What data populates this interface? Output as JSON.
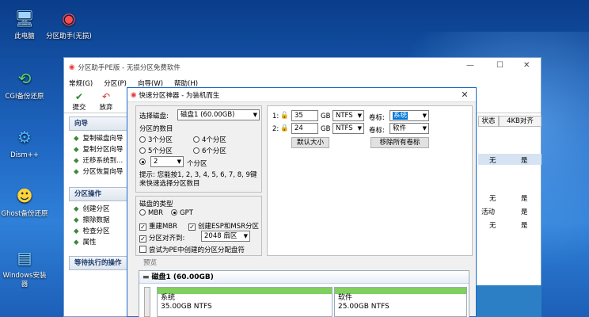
{
  "desktop": {
    "icons": [
      {
        "label": "此电脑",
        "glyph": "🖥"
      },
      {
        "label": "分区助手(无损)",
        "glyph": "◉"
      },
      {
        "label": "CGI备份还原",
        "glyph": "⟲"
      },
      {
        "label": "Dism++",
        "glyph": "⚙"
      },
      {
        "label": "Ghost备份还原",
        "glyph": "☻"
      },
      {
        "label": "Windows安装器",
        "glyph": "▤"
      }
    ]
  },
  "app": {
    "title": "分区助手PE版 - 无损分区免费软件",
    "window_controls": {
      "minimize": "—",
      "maximize": "☐",
      "close": "✕"
    },
    "menu": [
      "常规(G)",
      "分区(P)",
      "向导(W)",
      "帮助(H)"
    ],
    "toolbar": [
      "提交",
      "放弃"
    ],
    "left": {
      "wizard_title": "向导",
      "wizard_items": [
        "复制磁盘向导",
        "复制分区向导",
        "迁移系统到...",
        "分区恢复向导"
      ],
      "ops_title": "分区操作",
      "ops_items": [
        "创建分区",
        "擦除数据",
        "检查分区",
        "属性"
      ],
      "pending_title": "等待执行的操作"
    },
    "grid": {
      "headers": [
        "状态",
        "4KB对齐"
      ],
      "rows": [
        {
          "status": "无",
          "align": "是"
        },
        {
          "status": "无",
          "align": "是"
        },
        {
          "status": "活动",
          "align": "是"
        },
        {
          "status": "无",
          "align": "是"
        }
      ]
    }
  },
  "dialog": {
    "title": "快速分区神器 - 为装机而生",
    "close": "✕",
    "disk_label": "选择磁盘:",
    "disk_value": "磁盘1 (60.00GB)",
    "count_label": "分区的数目",
    "count_options": [
      "3个分区",
      "4个分区",
      "5个分区",
      "6个分区"
    ],
    "custom_value": "2",
    "custom_unit": "个分区",
    "hint": "提示: 您能按1, 2, 3, 4, 5, 6, 7, 8, 9键来快速选择分区数目",
    "type_label": "磁盘的类型",
    "mbr": "MBR",
    "gpt": "GPT",
    "opt_msr": "重建MBR",
    "opt_esp": "创建ESP和MSR分区",
    "opt_align": "分区对齐到:",
    "align_value": "2048 扇区",
    "opt_pe": "尝试为PE中创建的分区分配盘符",
    "rows": [
      {
        "idx": "1:",
        "size": "35",
        "unit": "GB",
        "fs": "NTFS",
        "vlabel": "卷标:",
        "vol": "系统"
      },
      {
        "idx": "2:",
        "size": "24",
        "unit": "GB",
        "fs": "NTFS",
        "vlabel": "卷标:",
        "vol": "软件"
      }
    ],
    "default_size": "默认大小",
    "remove_labels": "移除所有卷标",
    "preview_label": "预览",
    "disk_title": "磁盘1 (60.00GB)",
    "parts": [
      {
        "name": "系统",
        "info": "35.00GB NTFS"
      },
      {
        "name": "软件",
        "info": "25.00GB NTFS"
      }
    ]
  }
}
